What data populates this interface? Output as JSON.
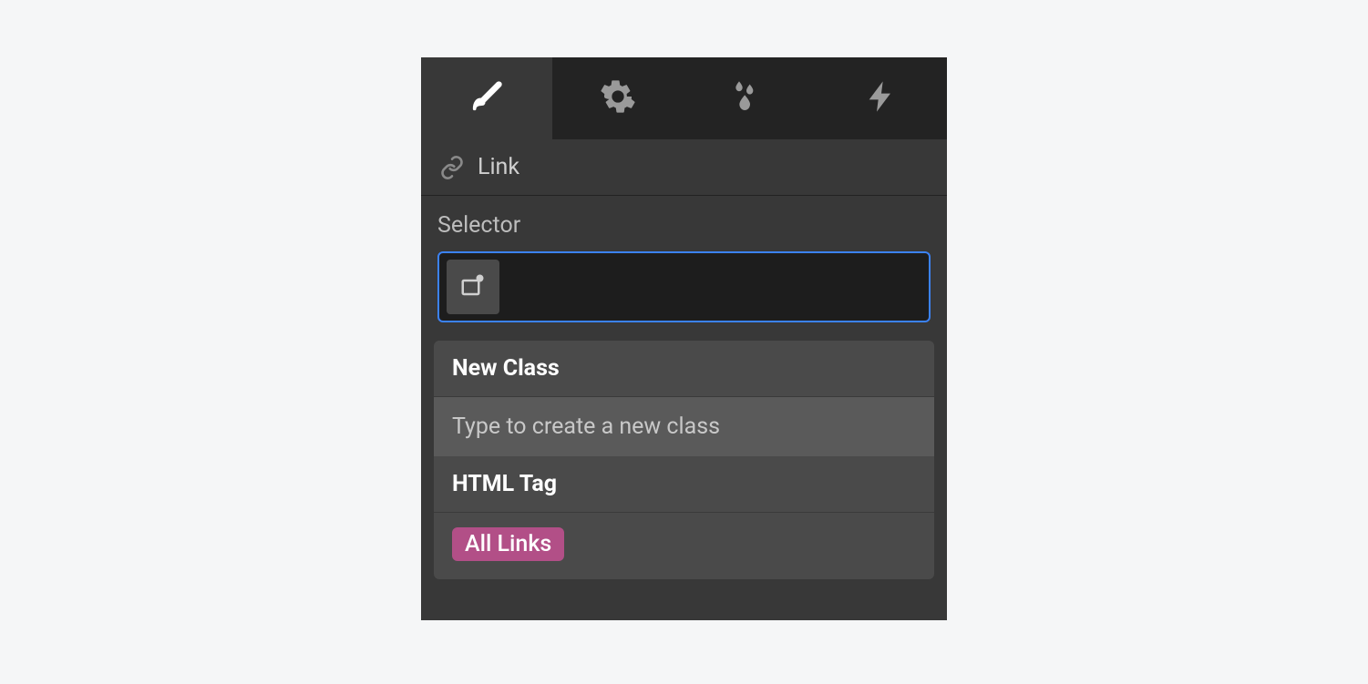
{
  "tabs": {
    "style": "style",
    "settings": "settings",
    "interactions": "interactions",
    "effects": "effects"
  },
  "element": {
    "type_label": "Link"
  },
  "selector": {
    "label": "Selector"
  },
  "dropdown": {
    "new_class_header": "New Class",
    "new_class_hint": "Type to create a new class",
    "html_tag_header": "HTML Tag",
    "all_links_badge": "All Links"
  }
}
